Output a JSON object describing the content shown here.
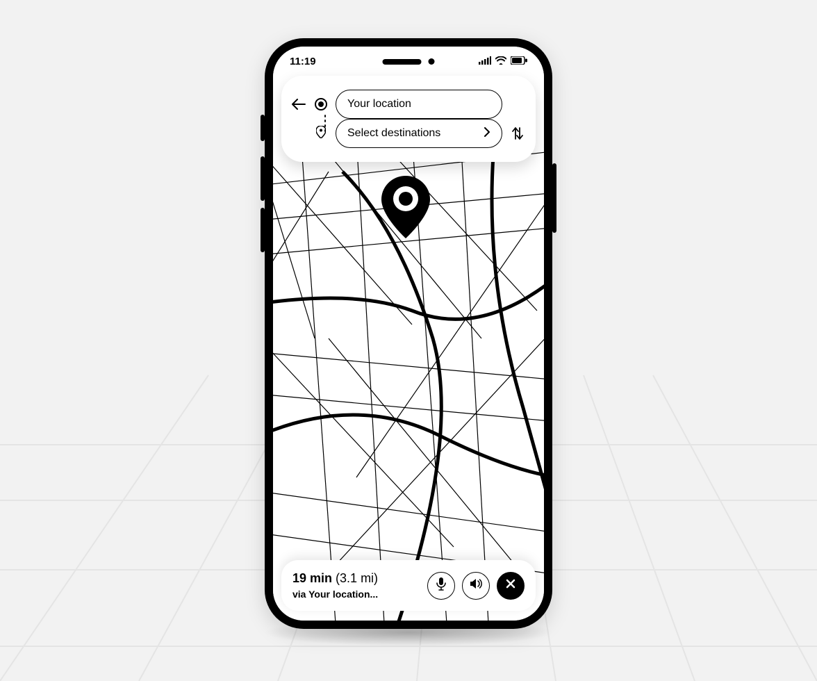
{
  "status_bar": {
    "time": "11:19"
  },
  "search": {
    "origin_placeholder": "Your location",
    "destination_placeholder": "Select destinations"
  },
  "trip": {
    "duration": "19 min",
    "distance": "(3.1 mi)",
    "via": "via Your location..."
  }
}
